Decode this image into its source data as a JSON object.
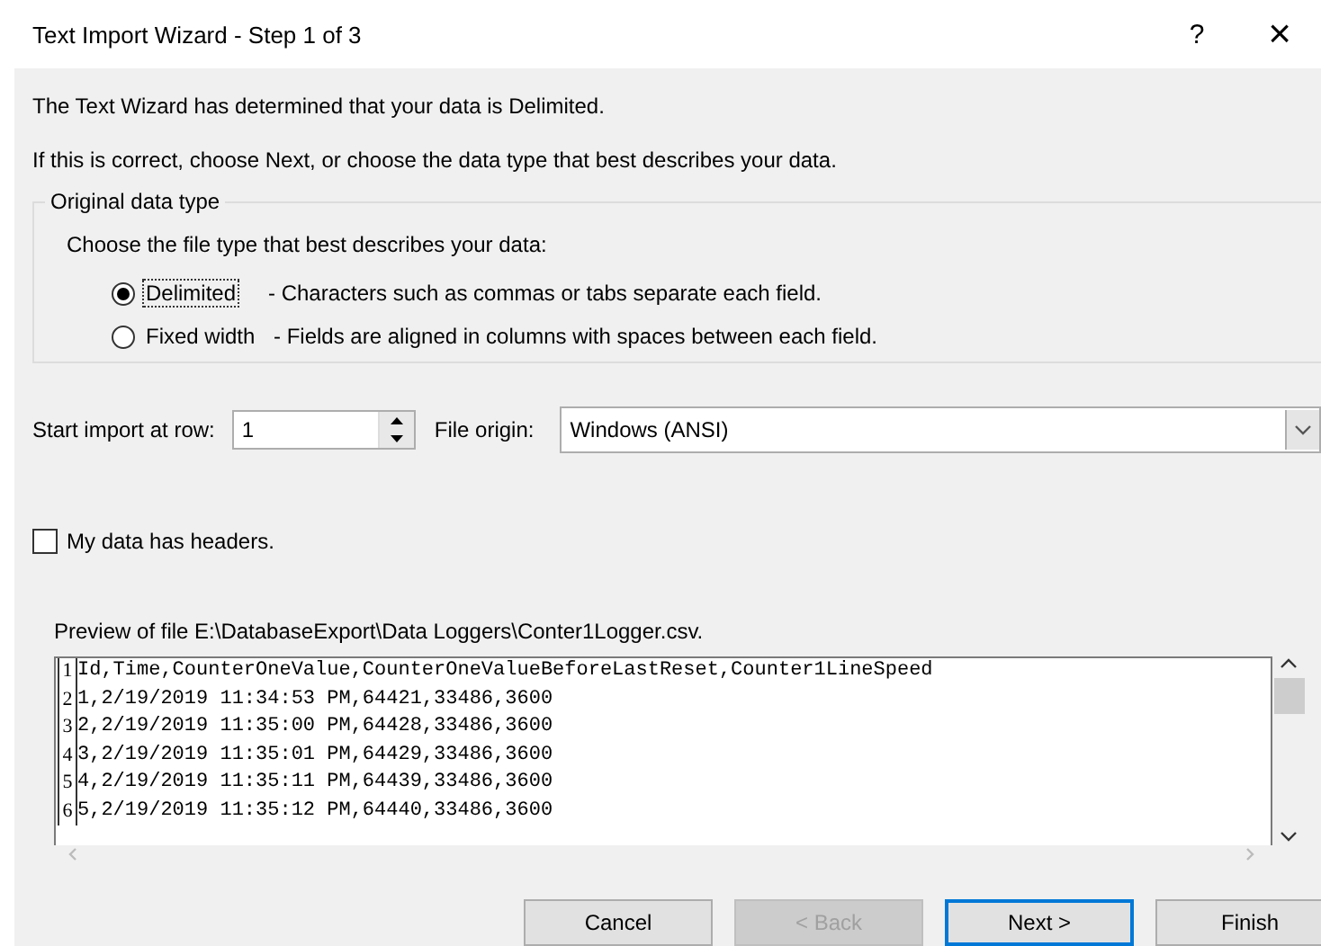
{
  "window": {
    "title": "Text Import Wizard - Step 1 of 3",
    "help": "?",
    "close": "×"
  },
  "intro": [
    "The Text Wizard has determined that your data is Delimited.",
    "If this is correct, choose Next, or choose the data type that best describes your data."
  ],
  "group": {
    "title": "Original data type",
    "prompt": "Choose the file type that best describes your data:",
    "options": [
      {
        "label": "Delimited",
        "description": "- Characters such as commas or tabs separate each field.",
        "selected": true,
        "focused": true
      },
      {
        "label": "Fixed width",
        "description": "- Fields are aligned in columns with spaces between each field.",
        "selected": false,
        "focused": false
      }
    ]
  },
  "start_row": {
    "label": "Start import at row:",
    "value": "1"
  },
  "file_origin": {
    "label": "File origin:",
    "value": "Windows (ANSI)"
  },
  "headers": {
    "label": "My data has headers.",
    "checked": false
  },
  "preview": {
    "label": "Preview of file E:\\DatabaseExport\\Data Loggers\\Conter1Logger.csv.",
    "rows": [
      {
        "number": "1",
        "text": "Id,Time,CounterOneValue,CounterOneValueBeforeLastReset,Counter1LineSpeed"
      },
      {
        "number": "2",
        "text": "1,2/19/2019 11:34:53 PM,64421,33486,3600"
      },
      {
        "number": "3",
        "text": "2,2/19/2019 11:35:00 PM,64428,33486,3600"
      },
      {
        "number": "4",
        "text": "3,2/19/2019 11:35:01 PM,64429,33486,3600"
      },
      {
        "number": "5",
        "text": "4,2/19/2019 11:35:11 PM,64439,33486,3600"
      },
      {
        "number": "6",
        "text": "5,2/19/2019 11:35:12 PM,64440,33486,3600"
      }
    ]
  },
  "buttons": [
    {
      "label": "Cancel",
      "disabled": false,
      "default": false
    },
    {
      "label": "< Back",
      "disabled": true,
      "default": false
    },
    {
      "label": "Next >",
      "disabled": false,
      "default": true
    },
    {
      "label": "Finish",
      "disabled": false,
      "default": false
    }
  ]
}
